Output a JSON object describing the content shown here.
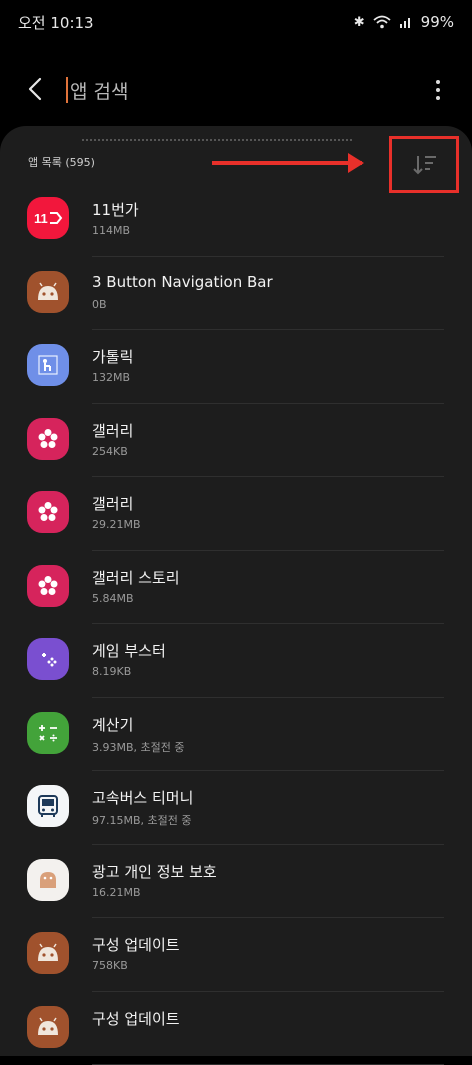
{
  "status_bar": {
    "time": "오전 10:13",
    "battery": "99%"
  },
  "search": {
    "value": "앱 검색"
  },
  "list": {
    "count_label": "앱 목록 (595)",
    "colors": {
      "annotation": "#e8302a"
    },
    "apps": [
      {
        "name": "11번가",
        "size": "114MB",
        "icon": "11st-icon"
      },
      {
        "name": "3 Button Navigation Bar",
        "size": "0B",
        "icon": "android-icon"
      },
      {
        "name": "가톨릭",
        "size": "132MB",
        "icon": "catholic-icon"
      },
      {
        "name": "갤러리",
        "size": "254KB",
        "icon": "gallery-icon"
      },
      {
        "name": "갤러리",
        "size": "29.21MB",
        "icon": "gallery-icon"
      },
      {
        "name": "갤러리 스토리",
        "size": "5.84MB",
        "icon": "gallery-icon"
      },
      {
        "name": "게임 부스터",
        "size": "8.19KB",
        "icon": "game-booster-icon"
      },
      {
        "name": "계산기",
        "size": "3.93MB, 초절전 중",
        "icon": "calculator-icon"
      },
      {
        "name": "고속버스 티머니",
        "size": "97.15MB, 초절전 중",
        "icon": "bus-icon"
      },
      {
        "name": "광고 개인 정보 보호",
        "size": "16.21MB",
        "icon": "android-light-icon"
      },
      {
        "name": "구성 업데이트",
        "size": "758KB",
        "icon": "android-icon"
      },
      {
        "name": "구성 업데이트",
        "size": "",
        "icon": "android-icon"
      }
    ]
  }
}
